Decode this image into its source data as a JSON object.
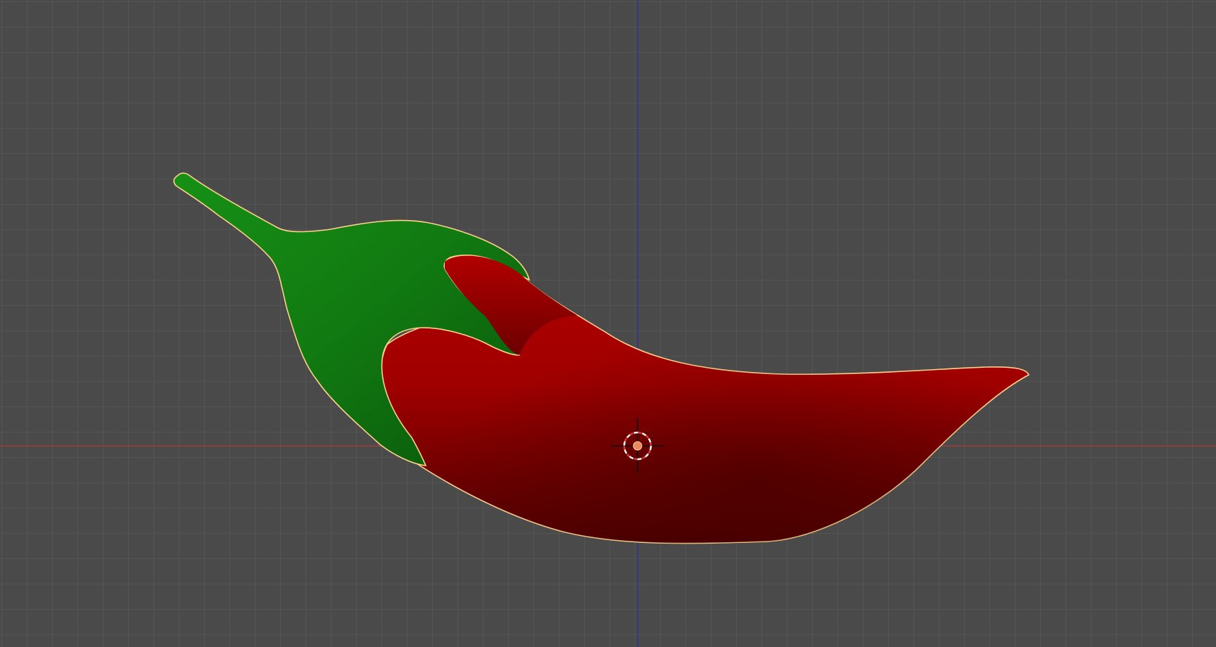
{
  "viewport": {
    "background_color": "#4a4a4a",
    "grid_color": "#5e5e5e",
    "x_axis_color": "#b73a3a",
    "y_axis_color": "#2d2d9a",
    "grid": true
  },
  "object": {
    "name": "chili-pepper",
    "body_color": "#a50000",
    "body_shadow_color": "#5a0000",
    "stem_color": "#117a11",
    "stem_shadow_color": "#0a4f0a",
    "selection_outline_color": "#ffd28a",
    "selected": true
  },
  "cursor_3d": {
    "icon": "3d-cursor-icon",
    "ring_color_a": "#ffffff",
    "ring_color_b": "#d23c3c",
    "center_color": "#e88a5a"
  }
}
